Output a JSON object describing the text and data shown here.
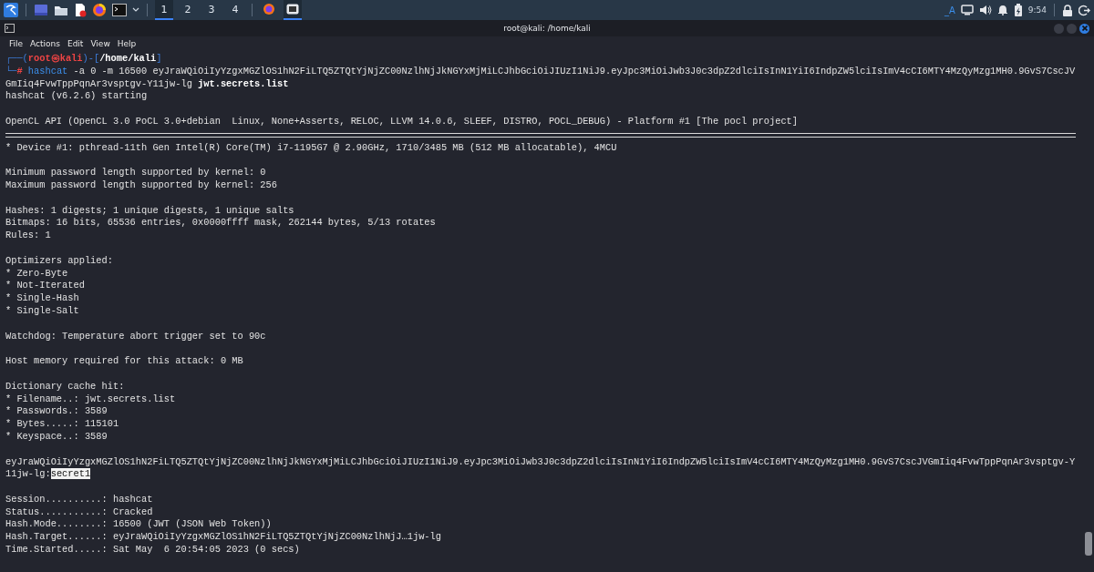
{
  "taskbar": {
    "workspaces": [
      {
        "label": "1",
        "selected": true
      },
      {
        "label": "2",
        "selected": false
      },
      {
        "label": "3",
        "selected": false
      },
      {
        "label": "4",
        "selected": false
      }
    ],
    "windows": [
      {
        "kind": "browser",
        "selected": false
      },
      {
        "kind": "terminal",
        "selected": true
      }
    ],
    "keyboard_layout": "_A",
    "clock": "9:54"
  },
  "window": {
    "title": "root@kali: /home/kali"
  },
  "menu": [
    "File",
    "Actions",
    "Edit",
    "View",
    "Help"
  ],
  "terminal": {
    "lines": [
      {
        "kind": "text",
        "segments": [
          {
            "kind": "frame",
            "text": "┌──("
          },
          {
            "kind": "user",
            "text": "root㉿kali"
          },
          {
            "kind": "frame",
            "text": ")-["
          },
          {
            "kind": "path",
            "text": "/home/kali"
          },
          {
            "kind": "frame",
            "text": "]"
          }
        ]
      },
      {
        "kind": "text",
        "segments": [
          {
            "kind": "frame",
            "text": "└─"
          },
          {
            "kind": "user",
            "text": "#"
          },
          {
            "kind": "cmd",
            "text": " hashcat"
          },
          {
            "kind": "plain",
            "text": " -a 0 -m 16500 eyJraWQiOiIyYzgxMGZlOS1hN2FiLTQ5ZTQtYjNjZC00NzlhNjJkNGYxMjMiLCJhbGciOiJIUzI1NiJ9.eyJpc3MiOiJwb3J0c3dpZ2dlciIsInN1YiI6IndpZW5lciIsImV4cCI6MTY4MzQyMzg1MH0.9GvS7CscJV"
          }
        ]
      },
      {
        "kind": "text",
        "segments": [
          {
            "kind": "plain",
            "text": "GmIiq4FvwTppPqnAr3vsptgv-Y11jw-lg "
          },
          {
            "kind": "bold",
            "text": "jwt.secrets.list"
          }
        ]
      },
      {
        "kind": "text",
        "segments": [
          {
            "kind": "plain",
            "text": "hashcat (v6.2.6) starting"
          }
        ]
      },
      {
        "kind": "blank"
      },
      {
        "kind": "text",
        "segments": [
          {
            "kind": "plain",
            "text": "OpenCL API (OpenCL 3.0 PoCL 3.0+debian  Linux, None+Asserts, RELOC, LLVM 14.0.6, SLEEF, DISTRO, POCL_DEBUG) - Platform #1 [The pocl project]"
          }
        ]
      },
      {
        "kind": "rule"
      },
      {
        "kind": "text",
        "segments": [
          {
            "kind": "plain",
            "text": "* Device #1: pthread-11th Gen Intel(R) Core(TM) i7-1195G7 @ 2.90GHz, 1710/3485 MB (512 MB allocatable), 4MCU"
          }
        ]
      },
      {
        "kind": "blank"
      },
      {
        "kind": "text",
        "segments": [
          {
            "kind": "plain",
            "text": "Minimum password length supported by kernel: 0"
          }
        ]
      },
      {
        "kind": "text",
        "segments": [
          {
            "kind": "plain",
            "text": "Maximum password length supported by kernel: 256"
          }
        ]
      },
      {
        "kind": "blank"
      },
      {
        "kind": "text",
        "segments": [
          {
            "kind": "plain",
            "text": "Hashes: 1 digests; 1 unique digests, 1 unique salts"
          }
        ]
      },
      {
        "kind": "text",
        "segments": [
          {
            "kind": "plain",
            "text": "Bitmaps: 16 bits, 65536 entries, 0x0000ffff mask, 262144 bytes, 5/13 rotates"
          }
        ]
      },
      {
        "kind": "text",
        "segments": [
          {
            "kind": "plain",
            "text": "Rules: 1"
          }
        ]
      },
      {
        "kind": "blank"
      },
      {
        "kind": "text",
        "segments": [
          {
            "kind": "plain",
            "text": "Optimizers applied:"
          }
        ]
      },
      {
        "kind": "text",
        "segments": [
          {
            "kind": "plain",
            "text": "* Zero-Byte"
          }
        ]
      },
      {
        "kind": "text",
        "segments": [
          {
            "kind": "plain",
            "text": "* Not-Iterated"
          }
        ]
      },
      {
        "kind": "text",
        "segments": [
          {
            "kind": "plain",
            "text": "* Single-Hash"
          }
        ]
      },
      {
        "kind": "text",
        "segments": [
          {
            "kind": "plain",
            "text": "* Single-Salt"
          }
        ]
      },
      {
        "kind": "blank"
      },
      {
        "kind": "text",
        "segments": [
          {
            "kind": "plain",
            "text": "Watchdog: Temperature abort trigger set to 90c"
          }
        ]
      },
      {
        "kind": "blank"
      },
      {
        "kind": "text",
        "segments": [
          {
            "kind": "plain",
            "text": "Host memory required for this attack: 0 MB"
          }
        ]
      },
      {
        "kind": "blank"
      },
      {
        "kind": "text",
        "segments": [
          {
            "kind": "plain",
            "text": "Dictionary cache hit:"
          }
        ]
      },
      {
        "kind": "text",
        "segments": [
          {
            "kind": "plain",
            "text": "* Filename..: jwt.secrets.list"
          }
        ]
      },
      {
        "kind": "text",
        "segments": [
          {
            "kind": "plain",
            "text": "* Passwords.: 3589"
          }
        ]
      },
      {
        "kind": "text",
        "segments": [
          {
            "kind": "plain",
            "text": "* Bytes.....: 115101"
          }
        ]
      },
      {
        "kind": "text",
        "segments": [
          {
            "kind": "plain",
            "text": "* Keyspace..: 3589"
          }
        ]
      },
      {
        "kind": "blank"
      },
      {
        "kind": "text",
        "segments": [
          {
            "kind": "plain",
            "text": "eyJraWQiOiIyYzgxMGZlOS1hN2FiLTQ5ZTQtYjNjZC00NzlhNjJkNGYxMjMiLCJhbGciOiJIUzI1NiJ9.eyJpc3MiOiJwb3J0c3dpZ2dlciIsInN1YiI6IndpZW5lciIsImV4cCI6MTY4MzQyMzg1MH0.9GvS7CscJVGmIiq4FvwTppPqnAr3vsptgv-Y"
          }
        ]
      },
      {
        "kind": "text",
        "segments": [
          {
            "kind": "plain",
            "text": "11jw-lg:"
          },
          {
            "kind": "highlight",
            "text": "secret1"
          }
        ]
      },
      {
        "kind": "blank"
      },
      {
        "kind": "text",
        "segments": [
          {
            "kind": "plain",
            "text": "Session..........: hashcat"
          }
        ]
      },
      {
        "kind": "text",
        "segments": [
          {
            "kind": "plain",
            "text": "Status...........: Cracked"
          }
        ]
      },
      {
        "kind": "text",
        "segments": [
          {
            "kind": "plain",
            "text": "Hash.Mode........: 16500 (JWT (JSON Web Token))"
          }
        ]
      },
      {
        "kind": "text",
        "segments": [
          {
            "kind": "plain",
            "text": "Hash.Target......: eyJraWQiOiIyYzgxMGZlOS1hN2FiLTQ5ZTQtYjNjZC00NzlhNjJ…1jw-lg"
          }
        ]
      },
      {
        "kind": "text",
        "segments": [
          {
            "kind": "plain",
            "text": "Time.Started.....: Sat May  6 20:54:05 2023 (0 secs)"
          }
        ]
      }
    ]
  }
}
